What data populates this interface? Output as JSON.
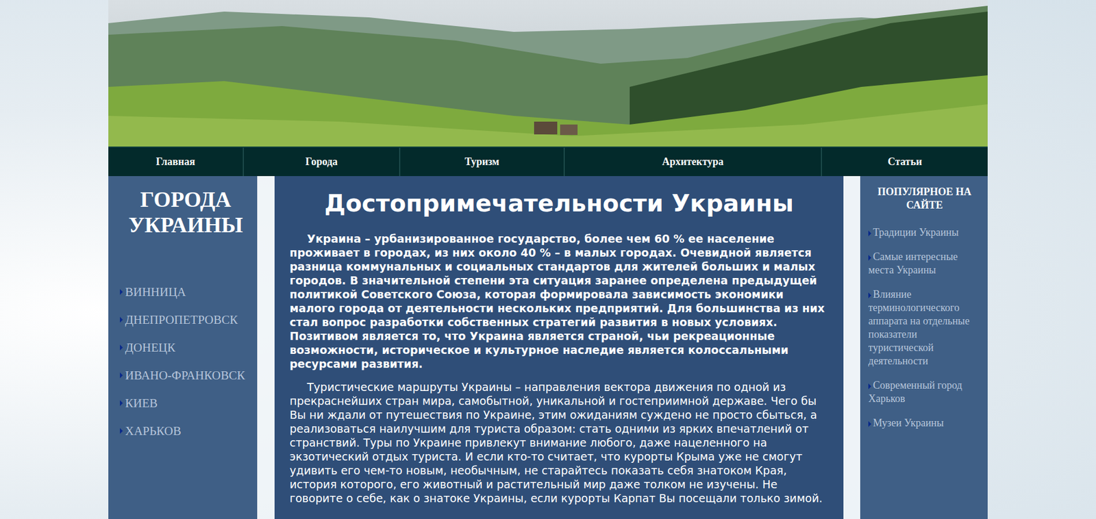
{
  "nav": [
    {
      "label": "Главная"
    },
    {
      "label": "Города"
    },
    {
      "label": "Туризм"
    },
    {
      "label": "Архитектура"
    },
    {
      "label": "Статьи"
    }
  ],
  "sidebar": {
    "title": "ГОРОДА УКРАИНЫ",
    "items": [
      {
        "label": "ВИННИЦА"
      },
      {
        "label": "ДНЕПРОПЕТРОВСК"
      },
      {
        "label": "ДОНЕЦК"
      },
      {
        "label": "ИВАНО-ФРАНКОВСК"
      },
      {
        "label": "КИЕВ"
      },
      {
        "label": "ХАРЬКОВ"
      }
    ]
  },
  "main": {
    "title": "Достопримечательности Украины",
    "paragraphs": [
      {
        "kind": "lead",
        "text": "Украина – урбанизированное государство, более чем 60 % ее население проживает в городах, из них около 40 % – в малых городах. Очевидной является разница коммунальных и социальных стандартов для жителей больших и малых городов. В значительной степени эта ситуация заранее определена предыдущей политикой Советского Союза, которая формировала зависимость экономики малого города от деятельности нескольких предприятий. Для большинства из них стал вопрос разработки собственных стратегий развития в новых условиях. Позитивом является то, что Украина является страной, чьи рекреационные возможности, историческое и культурное наследие является колоссальными ресурсами развития."
      },
      {
        "kind": "body",
        "text": "Туристические маршруты Украины – направления вектора движения по одной из прекраснейших стран мира, самобытной, уникальной и гостеприимной державе. Чего бы Вы ни ждали от путешествия по Украине, этим ожиданиям суждено не просто сбыться, а реализоваться наилучшим для туриста образом: стать одними из ярких впечатлений от странствий. Туры по Украине привлекут внимание любого, даже нацеленного на экзотический отдых туриста. И если кто-то считает, что курорты Крыма уже не смогут удивить его чем-то новым, необычным, не старайтесь показать себя знатоком Края, история которого, его животный и растительный мир даже толком не изучены. Не говорите о себе, как о знатоке Украины, если курорты Карпат Вы посещали только зимой."
      }
    ]
  },
  "popular": {
    "title": "ПОПУЛЯРНОЕ НА САЙТЕ",
    "items": [
      {
        "label": "Традиции Украины"
      },
      {
        "label": "Самые интересные места Украины"
      },
      {
        "label": "Влияние терминологического аппарата на отдельные показатели туристической деятельности"
      },
      {
        "label": "Современный город Харьков"
      },
      {
        "label": "Музеи Украины"
      }
    ]
  }
}
